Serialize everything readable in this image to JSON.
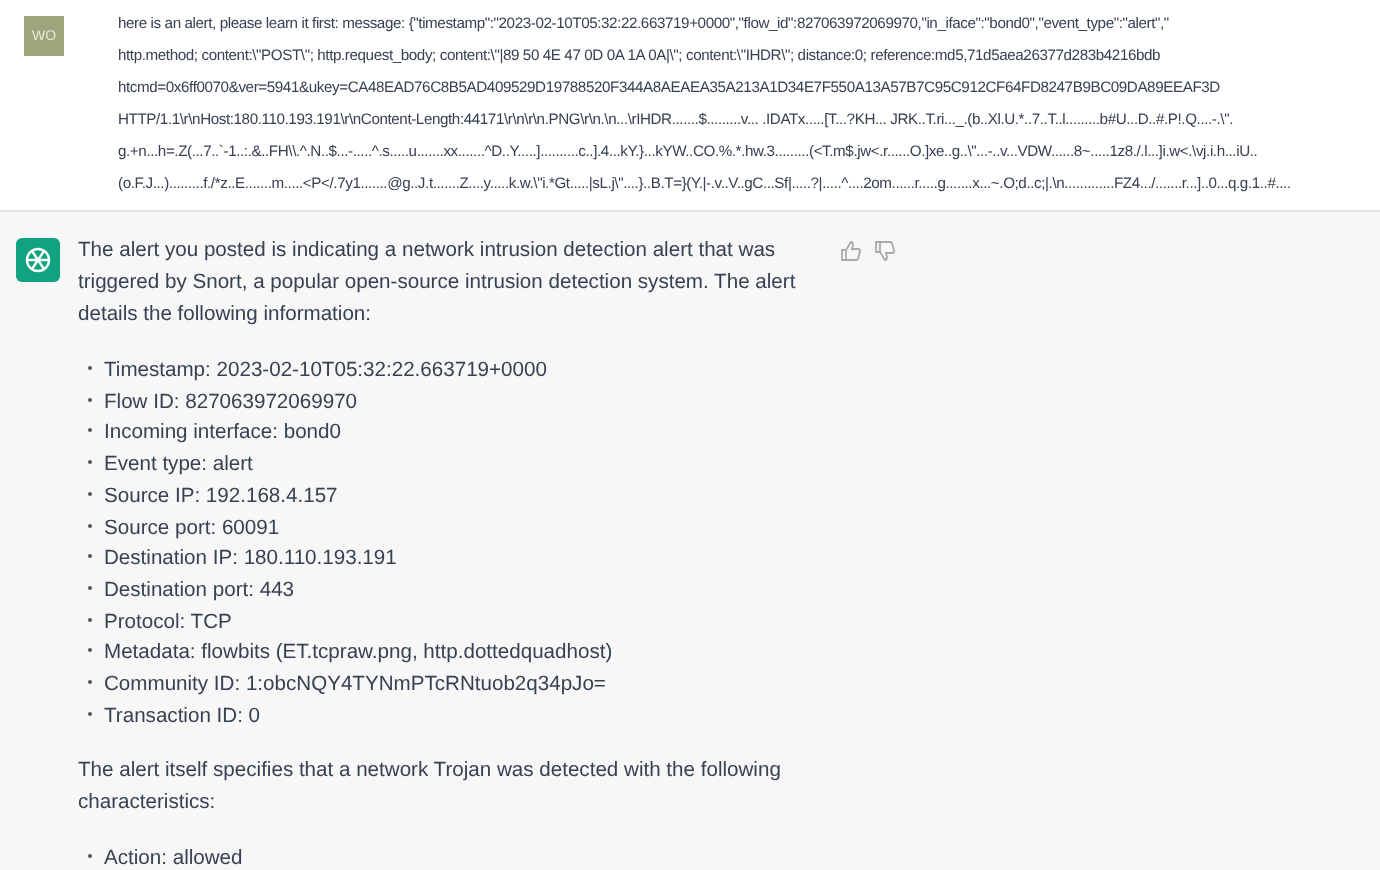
{
  "user_message": {
    "avatar": "WO",
    "lines": [
      "here is an alert, please learn it first: message: {\"timestamp\":\"2023-02-10T05:32:22.663719+0000\",\"flow_id\":827063972069970,\"in_iface\":\"bond0\",\"event_type\":\"alert\",\"",
      "http.method; content:\\\"POST\\\"; http.request_body; content:\\\"|89 50 4E 47 0D 0A 1A 0A|\\\"; content:\\\"IHDR\\\"; distance:0; reference:md5,71d5aea26377d283b4216bdb",
      "htcmd=0x6ff0070&ver=5941&ukey=CA48EAD76C8B5AD409529D19788520F344A8AEAEA35A213A1D34E7F550A13A57B7C95C912CF64FD8247B9BC09DA89EEAF3D",
      "HTTP/1.1\\r\\nHost:180.110.193.191\\r\\nContent-Length:44171\\r\\n\\r\\n.PNG\\r\\n.\\n...\\rIHDR.......$.........v... .IDATx.....[T...?KH... JRK..T.ri..._.(b..Xl.U.*..7..T..l.........b#U...D..#.P!.Q....-.\\\".",
      "g.+n...h=.Z(...7..`-1..:.&..FH\\\\.^.N..$...-.....^.s.....u.......xx.......^D..Y.....]..........c..].4...kY.}...kYW..CO.%.*.hw.3.........(<T.m$.jw<.r......O.]xe..g..\\\"...-..v...VDW......8~.....1z8./.l...]i.w<.\\vj.i.h...iU..",
      "(o.F.J...).........f./*z..E.......m.....<P</.7y1.......@g..J.t.......Z....y.....k.w.\\\"i.*Gt.....|sL.j\\\"....}..B.T=}(Y.|-.v..V..gC...Sf|.....?|.....^....2om......r.....g.......x...~.O;d..c;|.\\n.............FZ4.../.......r...]..0...q.g.1..#...."
    ]
  },
  "assistant_message": {
    "blocks": [
      {
        "kind": "paragraph",
        "text": "The alert you posted is indicating a network intrusion detection alert that was triggered by Snort, a popular open-source intrusion detection system. The alert details the following information:"
      },
      {
        "kind": "list",
        "items": [
          "Timestamp: 2023-02-10T05:32:22.663719+0000",
          "Flow ID: 827063972069970",
          "Incoming interface: bond0",
          "Event type: alert",
          "Source IP: 192.168.4.157",
          "Source port: 60091",
          "Destination IP: 180.110.193.191",
          "Destination port: 443",
          "Protocol: TCP",
          "Metadata: flowbits (ET.tcpraw.png, http.dottedquadhost)",
          "Community ID: 1:obcNQY4TYNmPTcRNtuob2q34pJo=",
          "Transaction ID: 0"
        ]
      },
      {
        "kind": "paragraph",
        "text": "The alert itself specifies that a network Trojan was detected with the following characteristics:"
      },
      {
        "kind": "list",
        "items": [
          "Action: allowed"
        ]
      }
    ]
  }
}
